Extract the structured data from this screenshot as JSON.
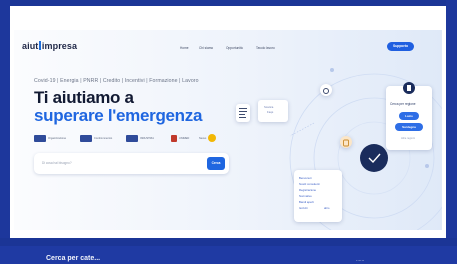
{
  "logo": {
    "text_left": "aiut",
    "text_right": "impresa"
  },
  "nav": {
    "items": [
      {
        "label": "Home"
      },
      {
        "label": "Chi siamo"
      },
      {
        "label": "Opportunità"
      },
      {
        "label": "Tavolo lavoro"
      }
    ],
    "support_label": "Supporto"
  },
  "hero": {
    "tagline": "Covid-19 | Energia | PNRR | Credito | Incentivi | Formazione | Lavoro",
    "title_line1": "Ti aiutiamo a",
    "title_line2": "superare l'emergenza"
  },
  "partners": [
    {
      "name": "Organizzazione",
      "color": "#2f4b9a"
    },
    {
      "name": "Confcommercio",
      "color": "#2f4b9a"
    },
    {
      "name": "INDUSTRIA",
      "color": "#2f4b9a"
    },
    {
      "name": "UNIMED",
      "color": "#c0392b"
    },
    {
      "name": "Nexus",
      "color": "#f2b705"
    }
  ],
  "search": {
    "placeholder": "Di cosa hai bisogno?",
    "button_label": "Cerca"
  },
  "illustration": {
    "card_center": {
      "line1": "Scarica",
      "line2": "Faqs"
    },
    "card_right": {
      "title": "Cerca per regione",
      "btn1": "Lazio",
      "btn2": "Sardegna",
      "link": "Altre regioni"
    },
    "card_bottom_lines": [
      "Benvenuti",
      "Nostri consulenti",
      "Registrazione",
      "Normative",
      "Bandi aperti",
      "Iscriviti"
    ],
    "card_bottom_extra": "altro"
  },
  "bottom": {
    "left_text": "Cerca per cate...",
    "right_text": "......"
  },
  "colors": {
    "frame": "#1f3aa3",
    "accent": "#1f66e0",
    "heading": "#121a33"
  }
}
